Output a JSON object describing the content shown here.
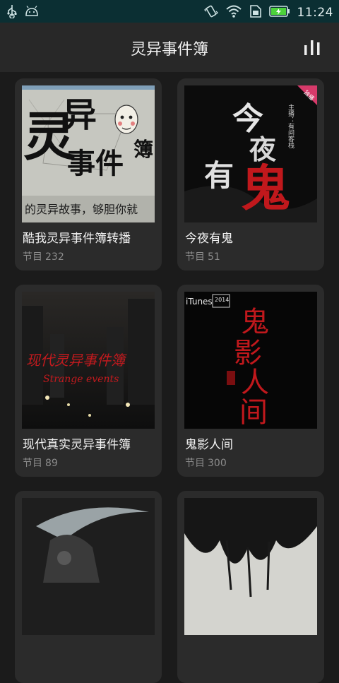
{
  "status_bar": {
    "time": "11:24",
    "icons": [
      "usb-icon",
      "android-icon",
      "vibrate-icon",
      "wifi-icon",
      "sim-icon",
      "battery-icon"
    ]
  },
  "header": {
    "title": "灵异事件簿",
    "menu_icon": "bar-chart-icon"
  },
  "cards": [
    {
      "title": "酷我灵异事件簿转播",
      "meta_label": "节目",
      "count": "232",
      "cover_text": [
        "灵",
        "异",
        "事件",
        "簿"
      ],
      "cover_caption": "的灵异故事，够胆你就"
    },
    {
      "title": "今夜有鬼",
      "meta_label": "节目",
      "count": "51",
      "cover_text": [
        "今",
        "夜",
        "有",
        "鬼"
      ],
      "cover_credit": "主播：有间客栈",
      "cover_badge": "独播"
    },
    {
      "title": "现代真实灵异事件簿",
      "meta_label": "节目",
      "count": "89",
      "cover_text": "现代灵异事件簿",
      "cover_subtitle": "Strange events"
    },
    {
      "title": "鬼影人间",
      "meta_label": "节目",
      "count": "300",
      "cover_text": [
        "鬼",
        "影",
        "人",
        "间"
      ],
      "cover_tag": "iTunes",
      "cover_year": "2014"
    },
    {
      "title": "",
      "meta_label": "",
      "count": ""
    },
    {
      "title": "",
      "meta_label": "",
      "count": ""
    }
  ],
  "colors": {
    "status_bar": "#0b2f33",
    "app_bar": "#282828",
    "background": "#1b1b1b",
    "card": "#2b2b2b",
    "accent_red": "#c0181c",
    "battery_green": "#4cd23a"
  }
}
